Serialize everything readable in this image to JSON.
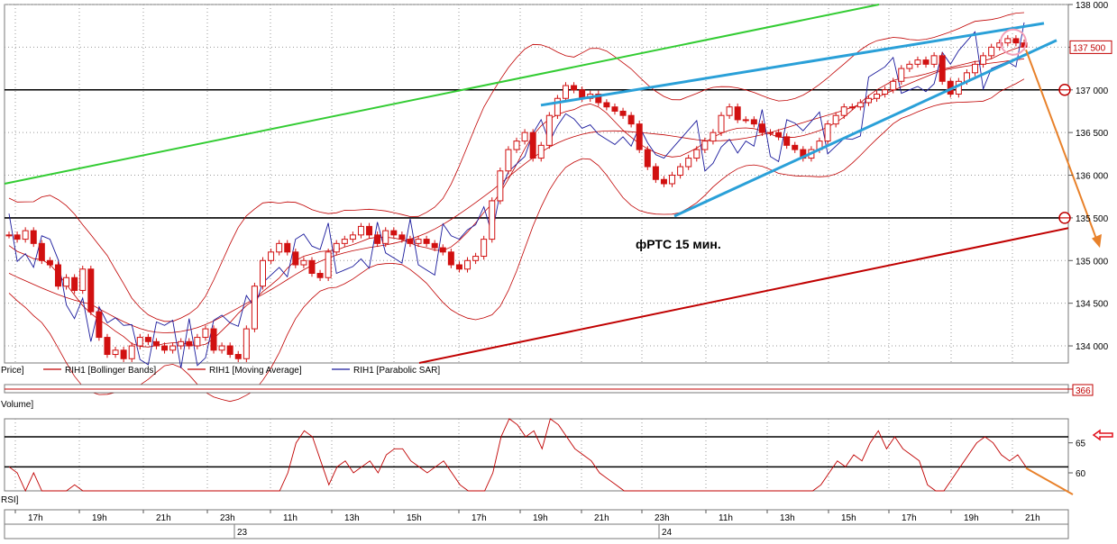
{
  "chart_data": [
    {
      "type": "candlestick",
      "panel": "price",
      "annotation": "фРТС   15 мин.",
      "price_label": "Price]",
      "legend": [
        {
          "name": "RIH1 [Bollinger Bands]",
          "color": "#c00000"
        },
        {
          "name": "RIH1 [Moving Average]",
          "color": "#c00000"
        },
        {
          "name": "RIH1 [Parabolic SAR]",
          "color": "#1a1a9c"
        }
      ],
      "ylim": [
        133800,
        138000
      ],
      "y_ticks": [
        "138 000",
        "137 500",
        "137 000",
        "136 500",
        "136 000",
        "135 500",
        "135 000",
        "134 500",
        "134 000"
      ],
      "last_price_label": "137 500",
      "horizontal_levels": [
        137000,
        135500
      ],
      "candles_approx": [
        135300,
        135250,
        135350,
        135200,
        135000,
        134950,
        134700,
        134800,
        134650,
        134900,
        134400,
        134100,
        133900,
        133950,
        133850,
        134000,
        134100,
        134050,
        134000,
        133950,
        134000,
        134050,
        134000,
        134100,
        134200,
        133950,
        134000,
        133900,
        133850,
        134200,
        134700,
        135000,
        135100,
        135200,
        135100,
        134950,
        135000,
        134850,
        134800,
        135100,
        135200,
        135250,
        135300,
        135400,
        135300,
        135200,
        135350,
        135300,
        135250,
        135200,
        135250,
        135200,
        135150,
        135100,
        134950,
        134900,
        135000,
        135050,
        135250,
        135700,
        136050,
        136300,
        136400,
        136500,
        136200,
        136350,
        136700,
        136900,
        137050,
        137000,
        136900,
        136950,
        136850,
        136800,
        136750,
        136700,
        136600,
        136300,
        136100,
        135950,
        135900,
        136000,
        136100,
        136200,
        136300,
        136400,
        136500,
        136700,
        136800,
        136650,
        136650,
        136600,
        136500,
        136500,
        136450,
        136350,
        136300,
        136200,
        136300,
        136400,
        136600,
        136700,
        136800,
        136800,
        136850,
        136900,
        136950,
        137000,
        137100,
        137250,
        137300,
        137350,
        137300,
        137400,
        137100,
        136950,
        137100,
        137200,
        137300,
        137400,
        137500,
        137550,
        137600,
        137550,
        137500
      ]
    },
    {
      "type": "line",
      "panel": "volume",
      "label": "Volume]",
      "last_value_label": "366"
    },
    {
      "type": "line",
      "panel": "rsi",
      "label": "RSI]",
      "ylim": [
        57,
        69
      ],
      "y_ticks": [
        "65",
        "60"
      ],
      "horizontal_levels": [
        66,
        61
      ],
      "values_approx": [
        61,
        60,
        57,
        60,
        57,
        57,
        57,
        57,
        58,
        57,
        57,
        57,
        57,
        57,
        57,
        57,
        57,
        57,
        57,
        57,
        57,
        57,
        57,
        57,
        57,
        57,
        57,
        57,
        57,
        57,
        57,
        57,
        57,
        57,
        60,
        65,
        67,
        66,
        62,
        58,
        61,
        62,
        60,
        61,
        62,
        60,
        63,
        64,
        64,
        62,
        61,
        60,
        61,
        62,
        60,
        58,
        57,
        57,
        57,
        60,
        66,
        69,
        68,
        66,
        67,
        64,
        69,
        68,
        66,
        64,
        63,
        62,
        60,
        59,
        58,
        57,
        57,
        57,
        57,
        57,
        57,
        57,
        57,
        57,
        57,
        57,
        57,
        57,
        57,
        57,
        57,
        57,
        57,
        57,
        57,
        57,
        57,
        57,
        57,
        58,
        60,
        62,
        61,
        63,
        62,
        65,
        67,
        64,
        66,
        64,
        63,
        62,
        58,
        57,
        57,
        59,
        61,
        63,
        65,
        66,
        65,
        63,
        62,
        63,
        61
      ]
    },
    {
      "type": "time_axis",
      "hour_ticks": [
        "17h",
        "19h",
        "21h",
        "23h",
        "11h",
        "13h",
        "15h",
        "17h",
        "19h",
        "21h",
        "23h",
        "11h",
        "13h",
        "15h",
        "17h",
        "19h",
        "21h"
      ],
      "day_labels": [
        "23",
        "24"
      ]
    }
  ],
  "colors": {
    "candle_body": "#d11010",
    "bollinger": "#c00000",
    "sar": "#1a1a9c",
    "green_line": "#33cc33",
    "blue_trend": "#2aa0d8",
    "dark_red_trend": "#c00000",
    "orange_arrow": "#e8812a",
    "grid": "#9a9a9a"
  }
}
